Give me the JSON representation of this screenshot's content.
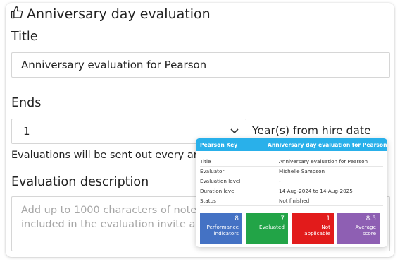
{
  "header": {
    "title": "Anniversary day evaluation",
    "icon": "thumbs-up-icon"
  },
  "form": {
    "title_label": "Title",
    "title_value": "Anniversary evaluation for Pearson",
    "ends_label": "Ends",
    "ends_value": "1",
    "ends_units": "Year(s) from hire date",
    "ends_note": "Evaluations will be sent out every ann",
    "desc_label": "Evaluation description",
    "desc_placeholder_line1": "Add up to 1000 characters of notes",
    "desc_placeholder_line2": "included in the evaluation invite and"
  },
  "popup": {
    "key_label": "Pearson Key",
    "title": "Anniversary day evaluation for Pearson",
    "header_color": "#29b0ea",
    "rows": [
      {
        "label": "Title",
        "value": "Anniversary evaluation for Pearson"
      },
      {
        "label": "Evaluator",
        "value": "Michelle Sampson"
      },
      {
        "label": "Evaluation level",
        "value": "-"
      },
      {
        "label": "Duration level",
        "value": "14-Aug-2024 to 14-Aug-2025"
      },
      {
        "label": "Status",
        "value": "Not finished"
      }
    ],
    "tiles": [
      {
        "number": "8",
        "caption_line1": "Performance",
        "caption_line2": "indicators",
        "color": "#4472c4"
      },
      {
        "number": "7",
        "caption_line1": "Evaluated",
        "caption_line2": "",
        "color": "#22a447"
      },
      {
        "number": "1",
        "caption_line1": "Not",
        "caption_line2": "applicable",
        "color": "#e21b1b"
      },
      {
        "number": "8.5",
        "caption_line1": "Average",
        "caption_line2": "score",
        "color": "#8e5fb3"
      }
    ]
  }
}
